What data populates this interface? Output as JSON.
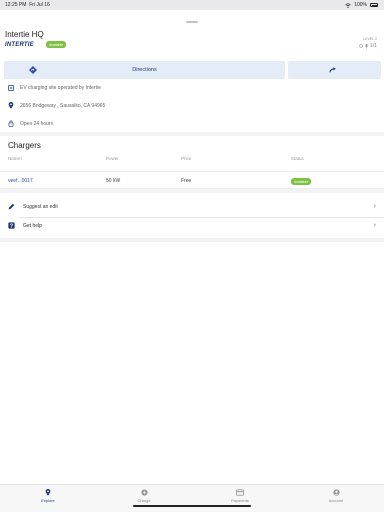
{
  "status_bar": {
    "time": "12:25 PM",
    "day": "Fri Jul 16",
    "battery": "100%"
  },
  "location": {
    "title": "Intertie HQ",
    "brand": "INTERTIE",
    "availability": "Available",
    "level_label": "LEVEL 2",
    "count": "1/1"
  },
  "actions": {
    "directions_label": "Directions"
  },
  "info": {
    "operator": "EV charging site operated by Intertie",
    "address": "2656 Bridgeway , Sausalito, CA 94965",
    "hours": "Open 24 hours"
  },
  "chargers": {
    "title": "Chargers",
    "columns": {
      "name": "Name",
      "sort": "↑",
      "power": "Power",
      "price": "Price",
      "status": "Status"
    },
    "rows": [
      {
        "name": "veef...0017",
        "power": "50 kW",
        "price": "Free",
        "status": "Available"
      }
    ]
  },
  "menu": [
    {
      "label": "Suggest an edit",
      "icon": "pencil-icon"
    },
    {
      "label": "Get help",
      "icon": "help-icon"
    }
  ],
  "tabs": [
    {
      "label": "Explore",
      "icon": "map-pin-icon",
      "active": true
    },
    {
      "label": "Charge",
      "icon": "bolt-icon",
      "active": false
    },
    {
      "label": "Payments",
      "icon": "card-icon",
      "active": false
    },
    {
      "label": "Account",
      "icon": "person-icon",
      "active": false
    }
  ],
  "colors": {
    "accent": "#1e3a7b",
    "available": "#7cc242",
    "button_bg": "#e4edf7"
  }
}
